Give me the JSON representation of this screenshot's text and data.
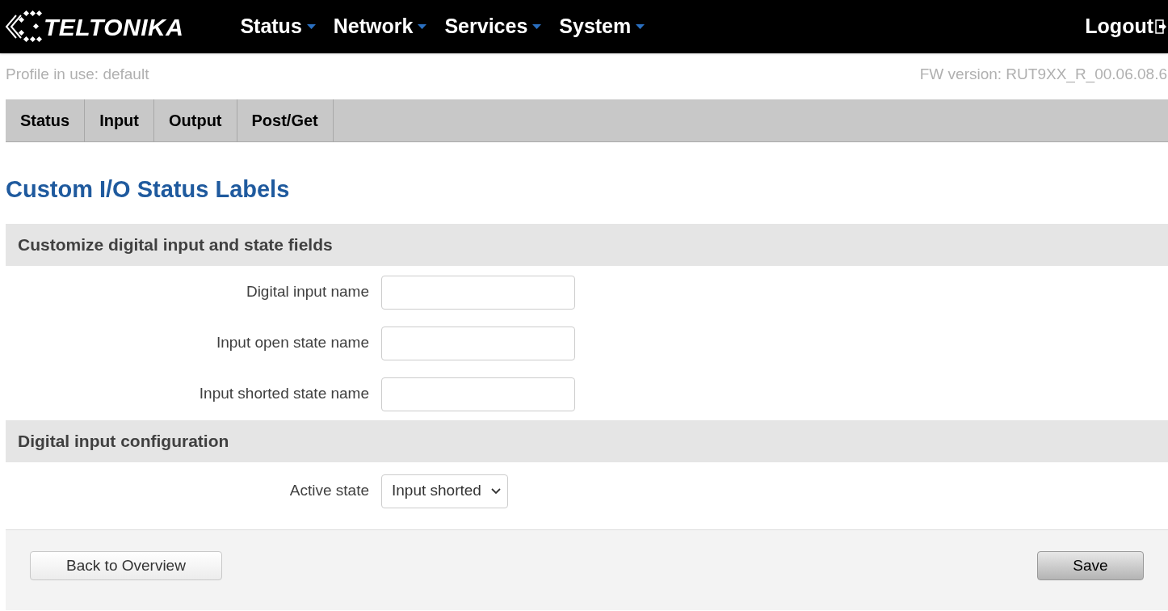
{
  "header": {
    "logo": "TELTONIKA",
    "menu": [
      {
        "label": "Status"
      },
      {
        "label": "Network"
      },
      {
        "label": "Services"
      },
      {
        "label": "System"
      }
    ],
    "logout": "Logout"
  },
  "info": {
    "profile": "Profile in use: default",
    "firmware": "FW version: RUT9XX_R_00.06.08.6"
  },
  "tabs": [
    {
      "label": "Status"
    },
    {
      "label": "Input"
    },
    {
      "label": "Output"
    },
    {
      "label": "Post/Get"
    }
  ],
  "title": "Custom I/O Status Labels",
  "sections": [
    {
      "heading": "Customize digital input and state fields",
      "fields": [
        {
          "kind": "text",
          "label": "Digital input name"
        },
        {
          "kind": "text",
          "label": "Input open state name"
        },
        {
          "kind": "text",
          "label": "Input shorted state name"
        }
      ]
    },
    {
      "heading": "Digital input configuration",
      "fields": [
        {
          "kind": "select",
          "label": "Active state",
          "value": "Input shorted"
        }
      ]
    }
  ],
  "footer": {
    "back": "Back to Overview",
    "save": "Save"
  }
}
